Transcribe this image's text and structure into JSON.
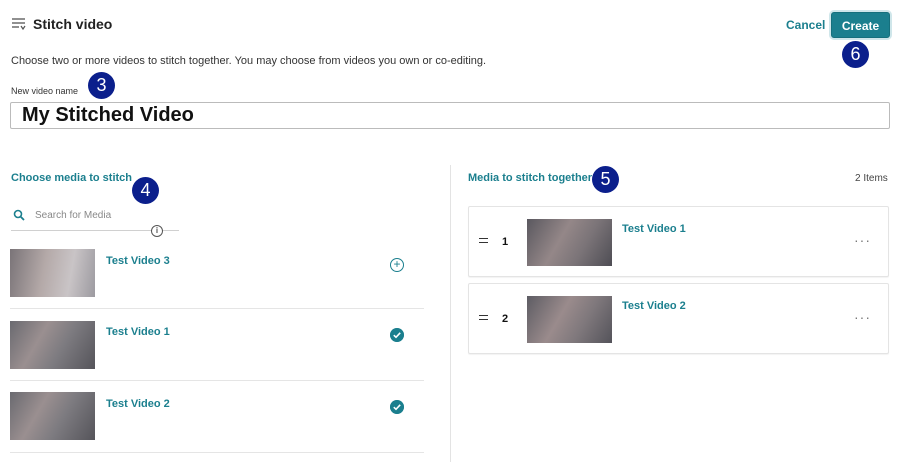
{
  "header": {
    "title": "Stitch video",
    "cancel_label": "Cancel",
    "create_label": "Create"
  },
  "description": "Choose two or more videos to stitch together. You may choose from videos you own or co-editing.",
  "name_field": {
    "label": "New video name",
    "value": "My Stitched Video"
  },
  "left_panel": {
    "title": "Choose media to stitch",
    "search_placeholder": "Search for Media",
    "info_glyph": "i",
    "items": [
      {
        "title": "Test Video 3",
        "state": "add",
        "icon": "plus-circle-icon"
      },
      {
        "title": "Test Video 1",
        "state": "selected",
        "icon": "check-circle-icon"
      },
      {
        "title": "Test Video 2",
        "state": "selected",
        "icon": "check-circle-icon"
      }
    ]
  },
  "right_panel": {
    "title": "Media to stitch together",
    "count": "2 Items",
    "items": [
      {
        "order": "1",
        "title": "Test Video 1",
        "more": "···"
      },
      {
        "order": "2",
        "title": "Test Video 2",
        "more": "···"
      }
    ]
  },
  "callouts": [
    "3",
    "4",
    "5",
    "6"
  ],
  "colors": {
    "accent": "#1b7f8e",
    "callout": "#0b1f8c"
  }
}
